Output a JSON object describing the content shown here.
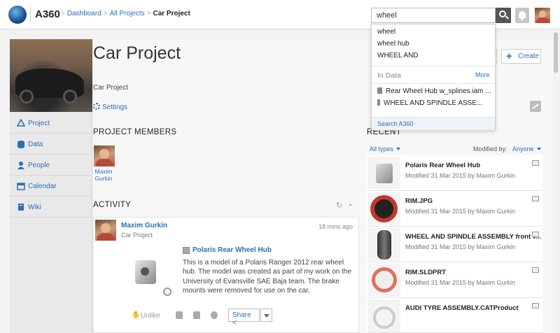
{
  "header": {
    "brand": "A360",
    "breadcrumb": [
      "Dashboard",
      "All Projects",
      "Car Project"
    ],
    "search_value": "wheel"
  },
  "sidebar": {
    "items": [
      {
        "label": "Project",
        "icon": "project-icon"
      },
      {
        "label": "Data",
        "icon": "database-icon"
      },
      {
        "label": "People",
        "icon": "person-icon"
      },
      {
        "label": "Calendar",
        "icon": "calendar-icon"
      },
      {
        "label": "Wiki",
        "icon": "book-icon"
      }
    ]
  },
  "project": {
    "title": "Car Project",
    "description": "Car Project",
    "settings_label": "Settings",
    "create_label": "Create"
  },
  "members": {
    "heading": "PROJECT MEMBERS",
    "list": [
      {
        "first": "Maxim",
        "last": "Gurkin"
      }
    ]
  },
  "activity": {
    "heading": "ACTIVITY",
    "user": "Maxim Gurkin",
    "project": "Car Project",
    "time": "18 mins ago",
    "item_title": "Polaris Rear Wheel Hub",
    "description": "This is a model of a Polaris Ranger 2012 rear wheel hub. The model was created as part of my work on the University of Evansville SAE Baja team. The brake mounts were removed for use on the car.",
    "unlike_label": "Unlike",
    "share_label": "Share"
  },
  "recent": {
    "heading": "RECENT",
    "filter_type": "All types",
    "modified_by_label": "Modified by",
    "modified_by_value": "Anyone",
    "items": [
      {
        "name": "Polaris Rear Wheel Hub",
        "meta": "Modified 31 Mar 2015 by Maxim Gurkin"
      },
      {
        "name": "RIM.JPG",
        "meta": "Modified 31 Mar 2015 by Maxim Gurkin"
      },
      {
        "name": "WHEEL AND SPINDLE ASSEMBLY front v...",
        "meta": "Modified 31 Mar 2015 by Maxim Gurkin"
      },
      {
        "name": "RIM.SLDPRT",
        "meta": "Modified 31 Mar 2015 by Maxim Gurkin"
      },
      {
        "name": "AUDI TYRE ASSEMBLY.CATProduct",
        "meta": ""
      }
    ]
  },
  "search_dropdown": {
    "suggestions": [
      "wheel",
      "wheel hub",
      "WHEEL AND"
    ],
    "section_label": "In Data",
    "more_label": "More",
    "files": [
      "Rear Wheel Hub w_splines.iam ...",
      "WHEEL AND SPINDLE ASSE..."
    ],
    "footer": "Search A360"
  },
  "colors": {
    "link": "#2a6fb8",
    "sidebar_bg": "#e9e9e9",
    "header_bg": "#ffffff"
  }
}
